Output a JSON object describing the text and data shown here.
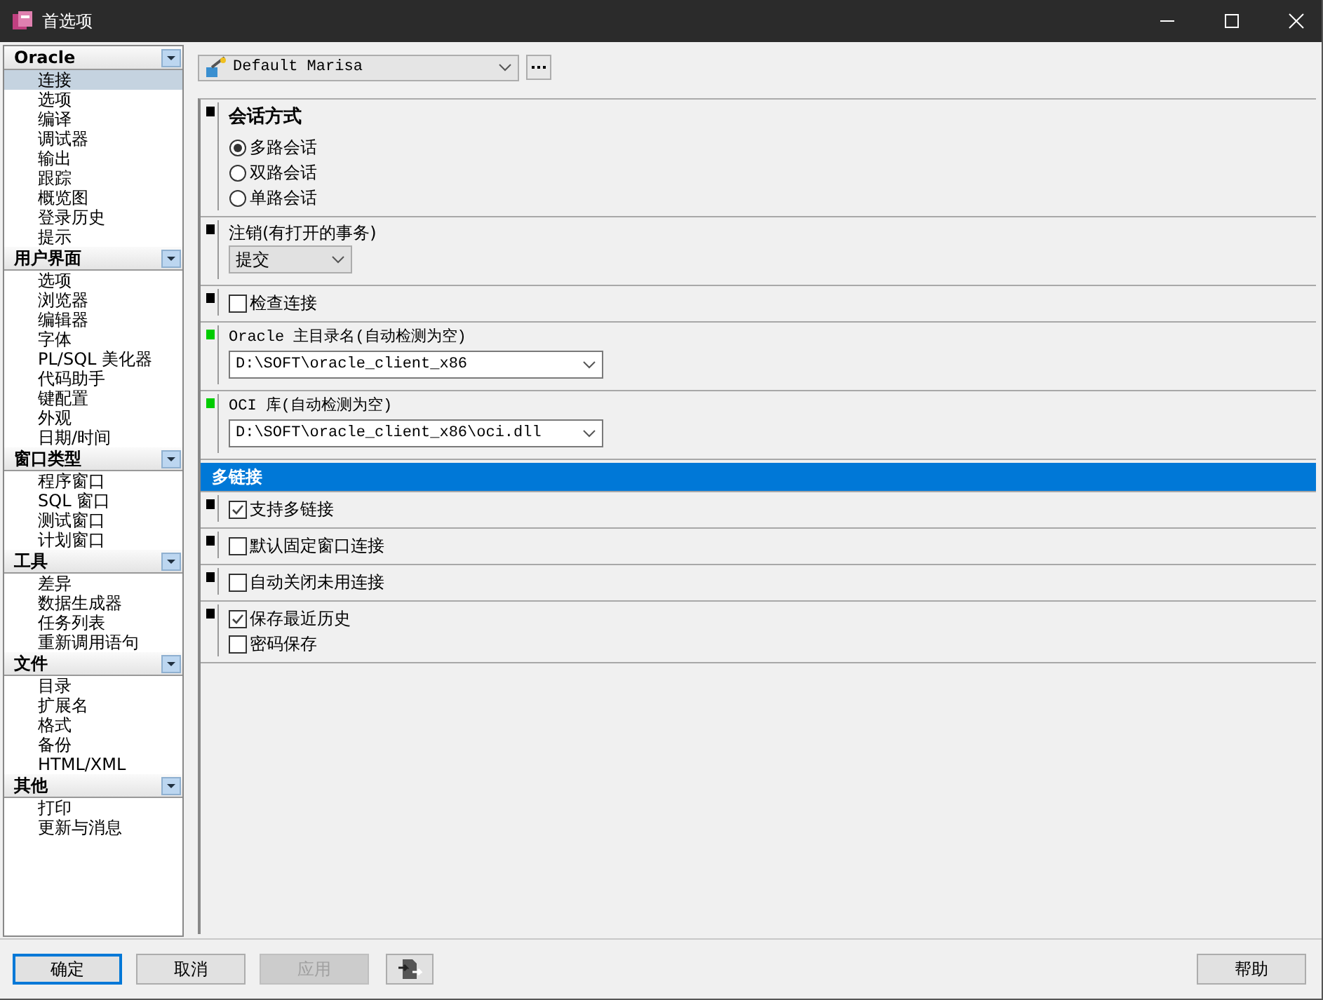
{
  "window": {
    "title": "首选项"
  },
  "sidebar": {
    "groups": [
      {
        "label": "Oracle",
        "items": [
          {
            "label": "连接",
            "selected": true
          },
          {
            "label": "选项",
            "selected": false
          },
          {
            "label": "编译",
            "selected": false
          },
          {
            "label": "调试器",
            "selected": false
          },
          {
            "label": "输出",
            "selected": false
          },
          {
            "label": "跟踪",
            "selected": false
          },
          {
            "label": "概览图",
            "selected": false
          },
          {
            "label": "登录历史",
            "selected": false
          },
          {
            "label": "提示",
            "selected": false
          }
        ]
      },
      {
        "label": "用户界面",
        "items": [
          {
            "label": "选项",
            "selected": false
          },
          {
            "label": "浏览器",
            "selected": false
          },
          {
            "label": "编辑器",
            "selected": false
          },
          {
            "label": "字体",
            "selected": false
          },
          {
            "label": "PL/SQL 美化器",
            "selected": false
          },
          {
            "label": "代码助手",
            "selected": false
          },
          {
            "label": "键配置",
            "selected": false
          },
          {
            "label": "外观",
            "selected": false
          },
          {
            "label": "日期/时间",
            "selected": false
          }
        ]
      },
      {
        "label": "窗口类型",
        "items": [
          {
            "label": "程序窗口",
            "selected": false
          },
          {
            "label": "SQL 窗口",
            "selected": false
          },
          {
            "label": "测试窗口",
            "selected": false
          },
          {
            "label": "计划窗口",
            "selected": false
          }
        ]
      },
      {
        "label": "工具",
        "items": [
          {
            "label": "差异",
            "selected": false
          },
          {
            "label": "数据生成器",
            "selected": false
          },
          {
            "label": "任务列表",
            "selected": false
          },
          {
            "label": "重新调用语句",
            "selected": false
          }
        ]
      },
      {
        "label": "文件",
        "items": [
          {
            "label": "目录",
            "selected": false
          },
          {
            "label": "扩展名",
            "selected": false
          },
          {
            "label": "格式",
            "selected": false
          },
          {
            "label": "备份",
            "selected": false
          },
          {
            "label": "HTML/XML",
            "selected": false
          }
        ]
      },
      {
        "label": "其他",
        "items": [
          {
            "label": "打印",
            "selected": false
          },
          {
            "label": "更新与消息",
            "selected": false
          }
        ]
      }
    ]
  },
  "profile": {
    "value": "Default Marisa"
  },
  "sections": [
    {
      "kind": "radio",
      "color": "#000000",
      "title": "会话方式",
      "options": [
        {
          "label": "多路会话",
          "selected": true
        },
        {
          "label": "双路会话",
          "selected": false
        },
        {
          "label": "单路会话",
          "selected": false
        }
      ]
    },
    {
      "kind": "select",
      "color": "#000000",
      "label": "注销(有打开的事务)",
      "value": "提交"
    },
    {
      "kind": "checks",
      "color": "#000000",
      "options": [
        {
          "label": "检查连接",
          "checked": false
        }
      ]
    },
    {
      "kind": "combo",
      "color": "#00cc00",
      "label": "Oracle 主目录名(自动检测为空)",
      "value": "D:\\SOFT\\oracle_client_x86"
    },
    {
      "kind": "combo",
      "color": "#00cc00",
      "label": "OCI 库(自动检测为空)",
      "value": "D:\\SOFT\\oracle_client_x86\\oci.dll"
    },
    {
      "kind": "header",
      "title": "多链接"
    },
    {
      "kind": "checks",
      "color": "#000000",
      "options": [
        {
          "label": "支持多链接",
          "checked": true
        }
      ]
    },
    {
      "kind": "checks",
      "color": "#000000",
      "options": [
        {
          "label": "默认固定窗口连接",
          "checked": false
        }
      ]
    },
    {
      "kind": "checks",
      "color": "#000000",
      "options": [
        {
          "label": "自动关闭未用连接",
          "checked": false
        }
      ]
    },
    {
      "kind": "checks",
      "color": "#000000",
      "options": [
        {
          "label": "保存最近历史",
          "checked": true
        },
        {
          "label": "密码保存",
          "checked": false
        }
      ]
    }
  ],
  "buttons": [
    {
      "kind": "text",
      "label": "确定",
      "default": true,
      "disabled": false
    },
    {
      "kind": "text",
      "label": "取消",
      "default": false,
      "disabled": false
    },
    {
      "kind": "text",
      "label": "应用",
      "default": false,
      "disabled": true
    },
    {
      "kind": "icon",
      "default": false,
      "disabled": false
    }
  ],
  "help_button": {
    "label": "帮助"
  }
}
